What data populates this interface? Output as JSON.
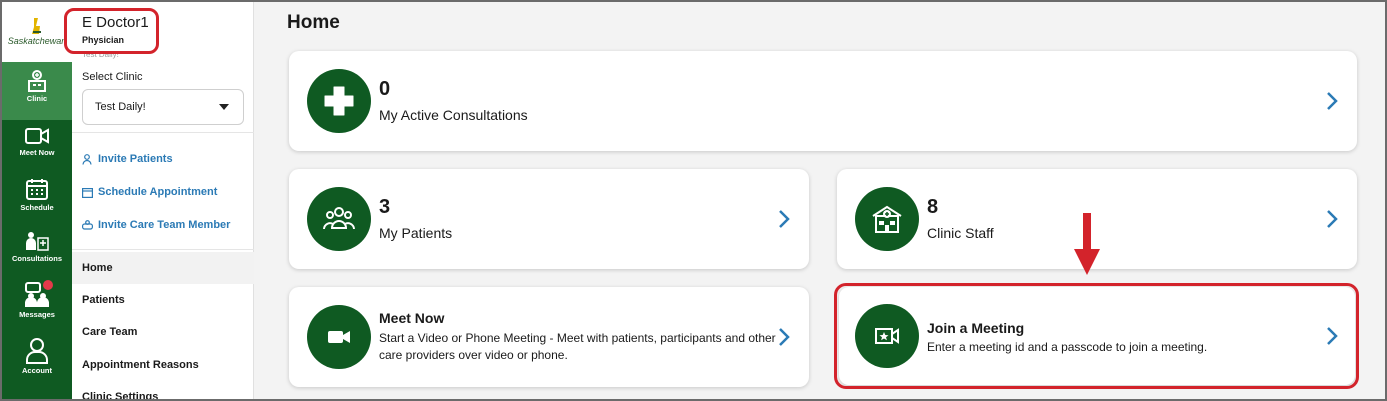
{
  "logo": {
    "text": "Saskatchewan"
  },
  "rail": [
    {
      "label": "Clinic",
      "icon": "clinic-icon",
      "active": true
    },
    {
      "label": "Meet Now",
      "icon": "video-icon"
    },
    {
      "label": "Schedule",
      "icon": "calendar-icon"
    },
    {
      "label": "Consultations",
      "icon": "consultations-icon"
    },
    {
      "label": "Messages",
      "icon": "messages-icon",
      "badge": true
    },
    {
      "label": "Account",
      "icon": "account-icon"
    }
  ],
  "user": {
    "name": "E Doctor1",
    "role": "Physician",
    "sub": "Test Daily!"
  },
  "clinic": {
    "label": "Select Clinic",
    "value": "Test Daily!"
  },
  "links": [
    "Invite Patients",
    "Schedule Appointment",
    "Invite Care Team Member"
  ],
  "nav": [
    "Home",
    "Patients",
    "Care Team",
    "Appointment Reasons",
    "Clinic Settings"
  ],
  "page_title": "Home",
  "cards": {
    "consultations": {
      "count": "0",
      "label": "My Active Consultations",
      "icon": "plus-cross-icon"
    },
    "patients": {
      "count": "3",
      "label": "My Patients",
      "icon": "group-icon"
    },
    "staff": {
      "count": "8",
      "label": "Clinic Staff",
      "icon": "hospital-icon"
    },
    "meet_now": {
      "title": "Meet Now",
      "desc": "Start a Video or Phone Meeting - Meet with patients, participants and other care providers over video or phone.",
      "icon": "video-camera-icon"
    },
    "join": {
      "title": "Join a Meeting",
      "desc": "Enter a meeting id and a passcode to join a meeting.",
      "icon": "join-meeting-icon"
    }
  },
  "colors": {
    "brand_green": "#0f5a22",
    "accent_blue": "#2b7ab5",
    "highlight_red": "#d3232b"
  }
}
